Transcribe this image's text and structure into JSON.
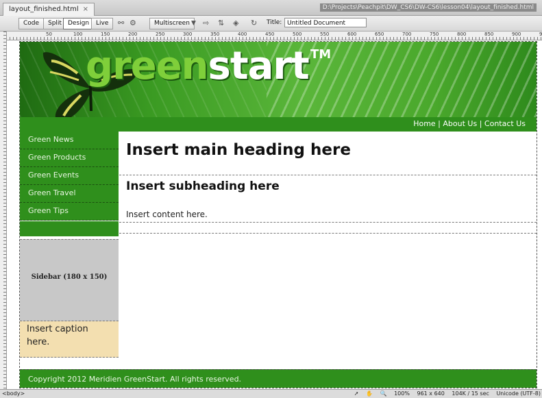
{
  "document": {
    "tab_label": "layout_finished.html",
    "close_glyph": "×",
    "path": "D:\\Projects\\Peachpit\\DW_CS6\\DW-CS6\\lesson04\\layout_finished.html"
  },
  "toolbar": {
    "code_label": "Code",
    "split_label": "Split",
    "design_label": "Design",
    "live_label": "Live",
    "multiscreen_label": "Multiscreen",
    "title_label": "Title:",
    "title_value": "Untitled Document"
  },
  "ruler": {
    "ticks": [
      "50",
      "100",
      "150",
      "200",
      "250",
      "300",
      "350",
      "400",
      "450",
      "500",
      "550",
      "600",
      "650",
      "700",
      "750",
      "800",
      "850",
      "900",
      "950"
    ]
  },
  "header": {
    "logo_part1": "green",
    "logo_part2": "start",
    "logo_tm": "TM",
    "nav_home": "Home",
    "nav_about": "About Us",
    "nav_contact": "Contact Us",
    "nav_separator": "|"
  },
  "sidebar": {
    "items": [
      {
        "label": "Green News"
      },
      {
        "label": "Green Products"
      },
      {
        "label": "Green Events"
      },
      {
        "label": "Green Travel"
      },
      {
        "label": "Green Tips"
      }
    ],
    "image_placeholder": "Sidebar (180 x 150)",
    "caption": "Insert caption here."
  },
  "content": {
    "heading": "Insert main heading here",
    "subheading": "Insert subheading here",
    "paragraph": "Insert content here."
  },
  "footer": {
    "text": "Copyright 2012 Meridien GreenStart. All rights reserved."
  },
  "statusbar": {
    "tag": "<body>",
    "zoom": "100%",
    "window_size": "961 x 640",
    "download": "104K / 15 sec",
    "encoding": "Unicode (UTF-8)"
  },
  "colors": {
    "brand_green": "#2f8f1c",
    "logo_light_green": "#7fcf3a",
    "caption_bg": "#f3dfb0",
    "placeholder_gray": "#c8c8c8"
  }
}
